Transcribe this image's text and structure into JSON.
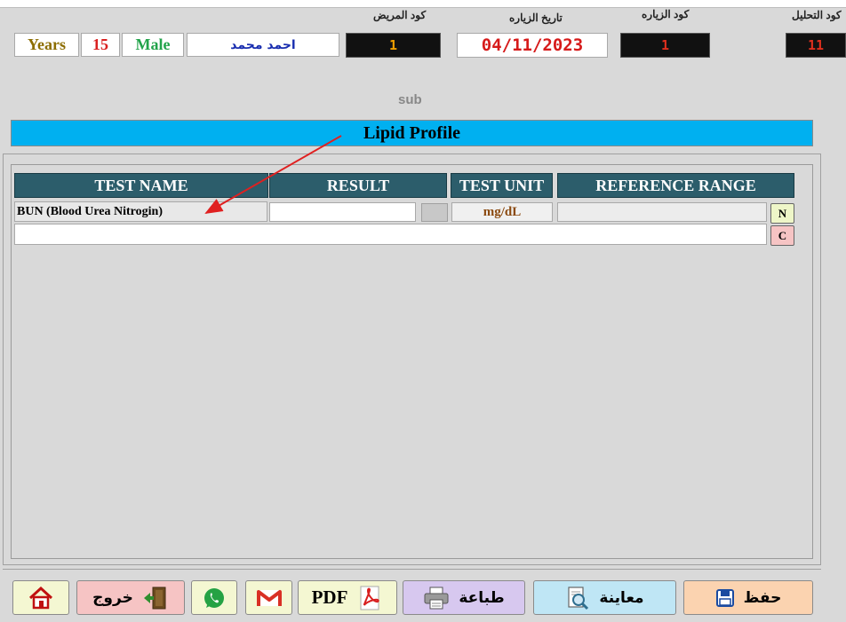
{
  "header": {
    "labels": {
      "analysis_code": "كود التحليل",
      "visit_code": "كود الزياره",
      "visit_date": "تاريخ الزياره",
      "patient_code": "كود المريض"
    },
    "age_unit": "Years",
    "age": "15",
    "gender": "Male",
    "patient_name": "احمد محمد",
    "patient_code": "1",
    "visit_date": "04/11/2023",
    "visit_code": "1",
    "analysis_code": "11"
  },
  "sub_label": "sub",
  "profile_title": "Lipid Profile",
  "table": {
    "columns": [
      "TEST NAME",
      "RESULT",
      "TEST UNIT",
      "REFERENCE RANGE"
    ],
    "rows": [
      {
        "test_name": "BUN (Blood Urea Nitrogin)",
        "result": "",
        "unit": "mg/dL",
        "reference": ""
      }
    ],
    "n_button": "N",
    "c_button": "C",
    "comment": ""
  },
  "buttons": {
    "save": "حفظ",
    "preview": "معاينة",
    "print": "طباعة",
    "pdf": "PDF",
    "exit": "خروج"
  },
  "colors": {
    "title_bar": "#00b0f0",
    "table_header": "#2c5d6b",
    "accent_red": "#e0301e"
  }
}
